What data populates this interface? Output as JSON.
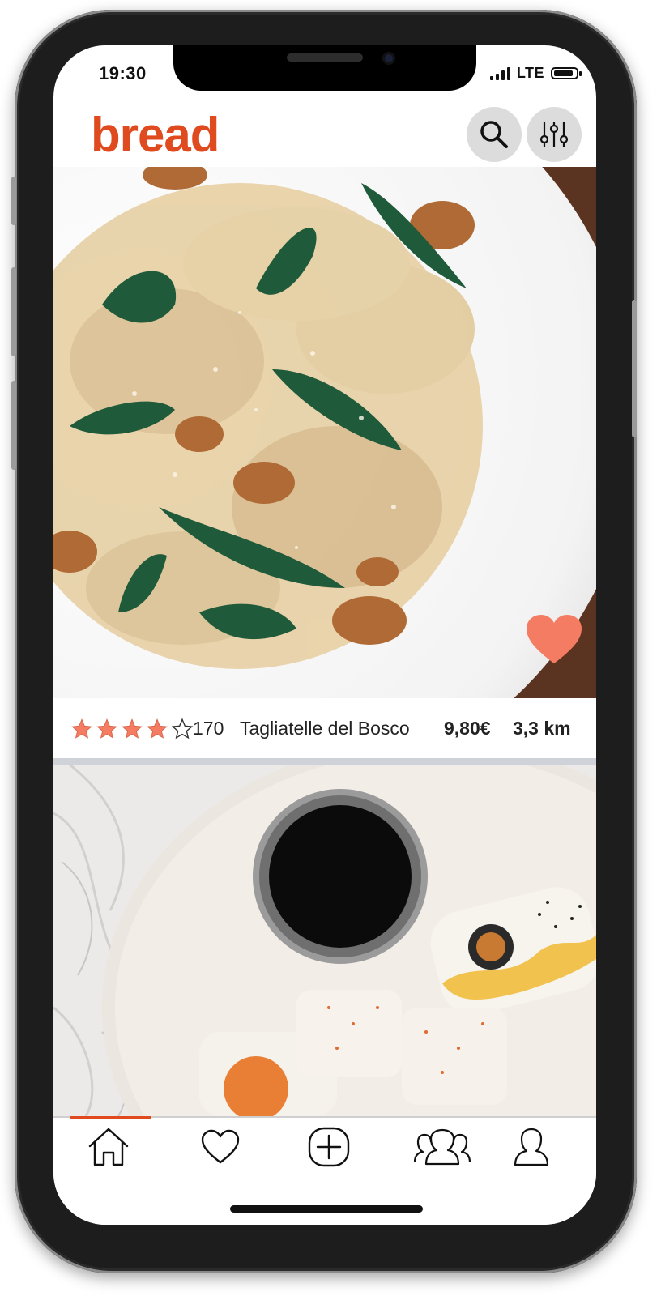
{
  "status_bar": {
    "time": "19:30",
    "network": "LTE"
  },
  "header": {
    "logo": "bread",
    "search_icon": "search-icon",
    "filter_icon": "sliders-icon"
  },
  "feed": [
    {
      "image": "tagliatelle-with-mushrooms-and-sage",
      "favorite": true,
      "rating": 4,
      "rating_max": 5,
      "reviews": "170",
      "name": "Tagliatelle del Bosco",
      "price": "9,80€",
      "distance": "3,3 km"
    },
    {
      "image": "sushi-rolls-with-soy-sauce"
    }
  ],
  "tabbar": {
    "active": "home",
    "items": [
      "home-icon",
      "heart-icon",
      "add-icon",
      "group-icon",
      "profile-icon"
    ]
  },
  "colors": {
    "brand": "#e04a1f",
    "favorite": "#f47c62",
    "star": "#f47c62",
    "divider": "#cfd3d9"
  }
}
